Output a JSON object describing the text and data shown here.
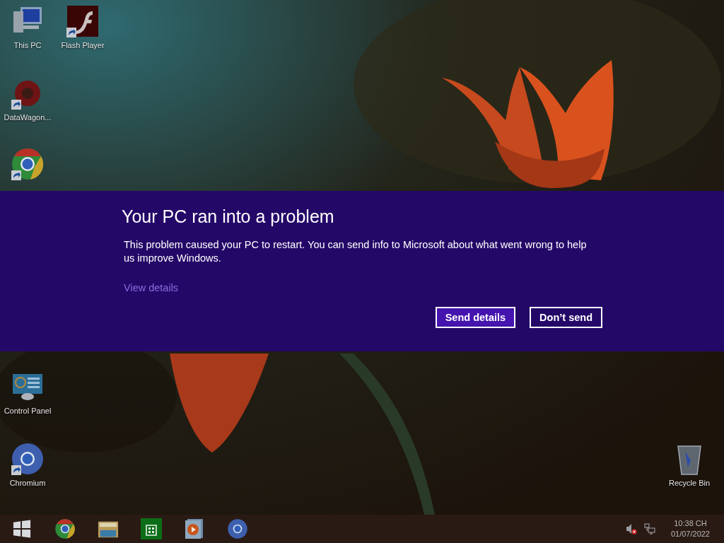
{
  "desktop_icons": [
    {
      "kind": "computer",
      "label": "This PC",
      "shortcut": false
    },
    {
      "kind": "flash",
      "label": "Flash Player",
      "shortcut": true
    },
    {
      "kind": "datawagon",
      "label": "DataWagon...",
      "shortcut": true
    },
    {
      "kind": "chrome",
      "shortcut": true
    },
    {
      "kind": "control-panel",
      "label": "Control Panel",
      "shortcut": false
    },
    {
      "kind": "chromium",
      "label": "Chromium",
      "shortcut": true
    },
    {
      "kind": "recycle-bin",
      "label": "Recycle Bin",
      "shortcut": false
    }
  ],
  "error_banner": {
    "title": "Your PC ran into a problem",
    "message": "This problem caused your PC to restart. You can send info to Microsoft about what went wrong to help us improve Windows.",
    "link": "View details",
    "buttons": [
      {
        "label": "Send details",
        "selected": true
      },
      {
        "label": "Don’t send",
        "selected": false
      }
    ]
  },
  "taskbar": {
    "items": [
      {
        "kind": "start"
      },
      {
        "kind": "chrome"
      },
      {
        "kind": "explorer"
      },
      {
        "kind": "store"
      },
      {
        "kind": "media"
      },
      {
        "kind": "chromium"
      }
    ],
    "tray": {
      "volume_muted": true,
      "time": "10:38 CH",
      "date": "01/07/2022"
    }
  }
}
